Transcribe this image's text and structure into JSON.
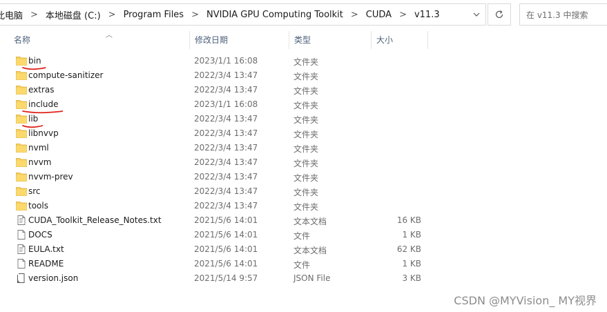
{
  "address": {
    "crumbs": [
      "此电脑",
      "本地磁盘 (C:)",
      "Program Files",
      "NVIDIA GPU Computing Toolkit",
      "CUDA",
      "v11.3"
    ],
    "separator": ">"
  },
  "search": {
    "placeholder": "在 v11.3 中搜索"
  },
  "columns": {
    "name": "名称",
    "date": "修改日期",
    "type": "类型",
    "size": "大小"
  },
  "files": [
    {
      "name": "bin",
      "date": "2023/1/1 16:08",
      "type": "文件夹",
      "size": "",
      "icon": "folder-icon",
      "underlined": true
    },
    {
      "name": "compute-sanitizer",
      "date": "2022/3/4 13:47",
      "type": "文件夹",
      "size": "",
      "icon": "folder-icon"
    },
    {
      "name": "extras",
      "date": "2022/3/4 13:47",
      "type": "文件夹",
      "size": "",
      "icon": "folder-icon"
    },
    {
      "name": "include",
      "date": "2023/1/1 16:08",
      "type": "文件夹",
      "size": "",
      "icon": "folder-icon",
      "underlined": true
    },
    {
      "name": "lib",
      "date": "2022/3/4 13:47",
      "type": "文件夹",
      "size": "",
      "icon": "folder-icon",
      "underlined": true
    },
    {
      "name": "libnvvp",
      "date": "2022/3/4 13:47",
      "type": "文件夹",
      "size": "",
      "icon": "folder-icon"
    },
    {
      "name": "nvml",
      "date": "2022/3/4 13:47",
      "type": "文件夹",
      "size": "",
      "icon": "folder-icon"
    },
    {
      "name": "nvvm",
      "date": "2022/3/4 13:47",
      "type": "文件夹",
      "size": "",
      "icon": "folder-icon"
    },
    {
      "name": "nvvm-prev",
      "date": "2022/3/4 13:47",
      "type": "文件夹",
      "size": "",
      "icon": "folder-icon"
    },
    {
      "name": "src",
      "date": "2022/3/4 13:47",
      "type": "文件夹",
      "size": "",
      "icon": "folder-icon"
    },
    {
      "name": "tools",
      "date": "2022/3/4 13:47",
      "type": "文件夹",
      "size": "",
      "icon": "folder-icon"
    },
    {
      "name": "CUDA_Toolkit_Release_Notes.txt",
      "date": "2021/5/6 14:01",
      "type": "文本文档",
      "size": "16 KB",
      "icon": "text-file-icon"
    },
    {
      "name": "DOCS",
      "date": "2021/5/6 14:01",
      "type": "文件",
      "size": "1 KB",
      "icon": "file-icon"
    },
    {
      "name": "EULA.txt",
      "date": "2021/5/6 14:01",
      "type": "文本文档",
      "size": "62 KB",
      "icon": "text-file-icon"
    },
    {
      "name": "README",
      "date": "2021/5/6 14:01",
      "type": "文件",
      "size": "1 KB",
      "icon": "file-icon"
    },
    {
      "name": "version.json",
      "date": "2021/5/14 9:57",
      "type": "JSON File",
      "size": "3 KB",
      "icon": "json-file-icon"
    }
  ],
  "watermark": "CSDN @MYVision_ MY视界",
  "colors": {
    "folder": "#f7cf5f",
    "annotation": "#e0201a",
    "header_text": "#4c607a"
  }
}
